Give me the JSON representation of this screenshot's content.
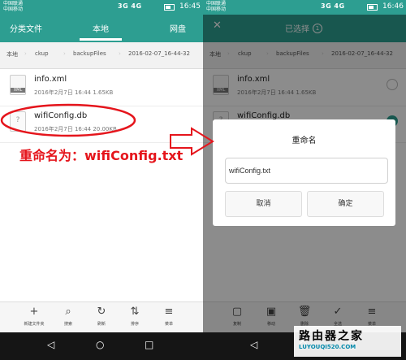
{
  "left": {
    "status": {
      "carrier1": "中国联通",
      "carrier2": "中国移动",
      "signals": "3G 4G",
      "time": "16:45"
    },
    "tabs": [
      "分类文件",
      "本地",
      "网盘"
    ],
    "breadcrumb": [
      "本地",
      "ckup",
      "backupFiles",
      "2016-02-07_16-44-32"
    ],
    "files": [
      {
        "name": "info.xml",
        "meta": "2016年2月7日 16:44 1.65KB",
        "icon_text": "XML"
      },
      {
        "name": "wifiConfig.db",
        "meta": "2016年2月7日 16:44 20.00KB",
        "icon_text": "?"
      }
    ],
    "toolbar": [
      {
        "icon": "+",
        "label": "新建文件夹"
      },
      {
        "icon": "⌕",
        "label": "搜索"
      },
      {
        "icon": "↻",
        "label": "刷新"
      },
      {
        "icon": "⇅",
        "label": "排序"
      },
      {
        "icon": "≡",
        "label": "菜单"
      }
    ]
  },
  "right": {
    "status": {
      "carrier1": "中国联通",
      "carrier2": "中国移动",
      "signals": "3G 4G",
      "time": "16:46"
    },
    "title": "已选择",
    "count": "1",
    "breadcrumb": [
      "本地",
      "ckup",
      "backupFiles",
      "2016-02-07_16-44-32"
    ],
    "files": [
      {
        "name": "info.xml",
        "meta": "2016年2月7日 16:44 1.65KB",
        "icon_text": "XML"
      },
      {
        "name": "wifiConfig.db",
        "meta": "",
        "icon_text": "?"
      }
    ],
    "dialog": {
      "title": "重命名",
      "input_value": "wifiConfig.txt",
      "cancel": "取消",
      "confirm": "确定"
    },
    "toolbar": [
      {
        "icon": "▢",
        "label": "复制"
      },
      {
        "icon": "▣",
        "label": "移动"
      },
      {
        "icon": "🗑",
        "label": "删除"
      },
      {
        "icon": "✓",
        "label": "全选"
      },
      {
        "icon": "≡",
        "label": "菜单"
      }
    ]
  },
  "annotation": "重命名为：wifiConfig.txt",
  "watermark": {
    "main": "路由器之家",
    "sub": "LUYOUQI520.COM"
  },
  "colors": {
    "header": "#2d9e91",
    "annotation": "#e5151c",
    "checkbox": "#2d9e91"
  }
}
